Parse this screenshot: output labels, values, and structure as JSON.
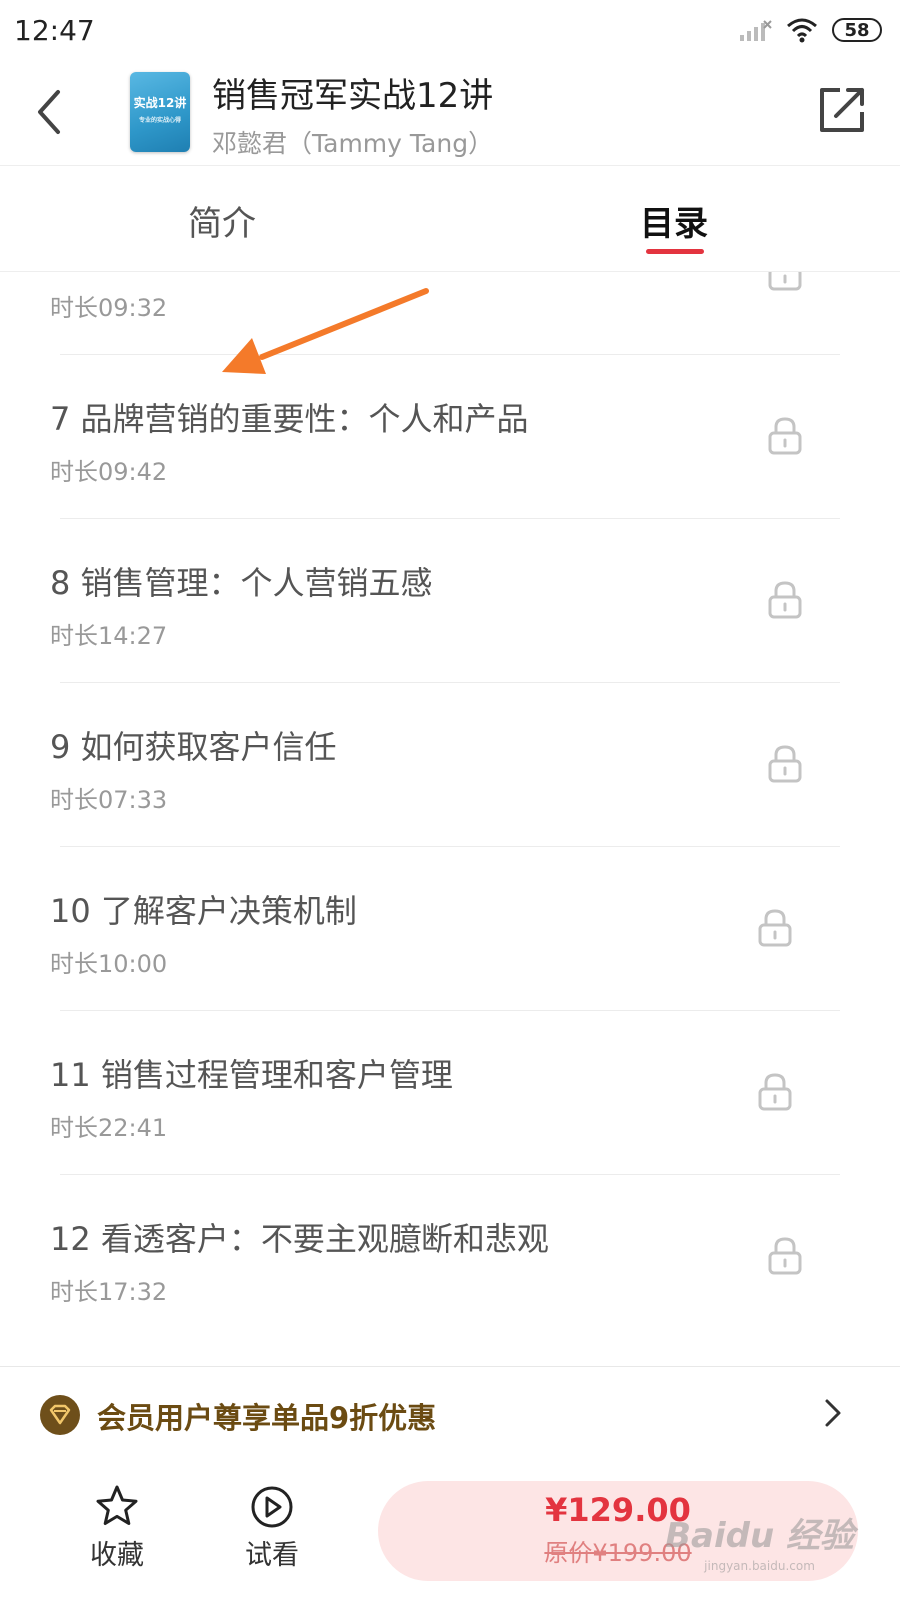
{
  "status_bar": {
    "time": "12:47",
    "battery": "58"
  },
  "header": {
    "cover_title": "实战12讲",
    "cover_subtitle": "专业的实战心得",
    "title": "销售冠军实战12讲",
    "author": "邓懿君（Tammy Tang）"
  },
  "tabs": [
    {
      "label": "简介",
      "active": false
    },
    {
      "label": "目录",
      "active": true
    }
  ],
  "lessons": [
    {
      "title": "",
      "duration": "时长09:32",
      "locked": true
    },
    {
      "title": "7 品牌营销的重要性：个人和产品",
      "duration": "时长09:42",
      "locked": true
    },
    {
      "title": "8 销售管理：个人营销五感",
      "duration": "时长14:27",
      "locked": true
    },
    {
      "title": "9 如何获取客户信任",
      "duration": "时长07:33",
      "locked": true
    },
    {
      "title": "10 了解客户决策机制",
      "duration": "时长10:00",
      "locked": true
    },
    {
      "title": "11  销售过程管理和客户管理",
      "duration": "时长22:41",
      "locked": true
    },
    {
      "title": "12 看透客户：不要主观臆断和悲观",
      "duration": "时长17:32",
      "locked": true
    }
  ],
  "promo": {
    "text": "会员用户尊享单品9折优惠"
  },
  "bottom_bar": {
    "favorite_label": "收藏",
    "trial_label": "试看",
    "price": "¥129.00",
    "original_price": "原价¥199.00"
  },
  "watermark": {
    "logo": "Baidu 经验",
    "url": "jingyan.baidu.com"
  },
  "colors": {
    "accent": "#e3343f",
    "promo_text": "#6b4b12",
    "buy_button_bg": "#fde5e5",
    "annotation_arrow": "#f47a2a"
  }
}
